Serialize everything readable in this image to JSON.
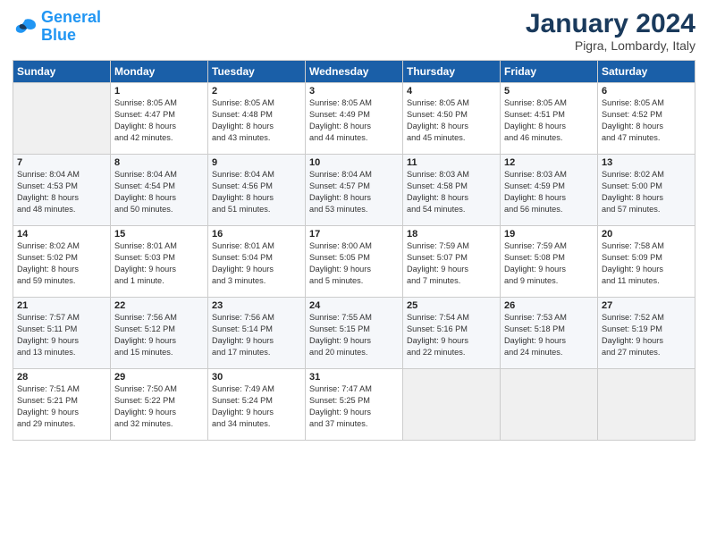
{
  "header": {
    "logo_line1": "General",
    "logo_line2": "Blue",
    "month": "January 2024",
    "location": "Pigra, Lombardy, Italy"
  },
  "weekdays": [
    "Sunday",
    "Monday",
    "Tuesday",
    "Wednesday",
    "Thursday",
    "Friday",
    "Saturday"
  ],
  "weeks": [
    [
      {
        "num": "",
        "info": ""
      },
      {
        "num": "1",
        "info": "Sunrise: 8:05 AM\nSunset: 4:47 PM\nDaylight: 8 hours\nand 42 minutes."
      },
      {
        "num": "2",
        "info": "Sunrise: 8:05 AM\nSunset: 4:48 PM\nDaylight: 8 hours\nand 43 minutes."
      },
      {
        "num": "3",
        "info": "Sunrise: 8:05 AM\nSunset: 4:49 PM\nDaylight: 8 hours\nand 44 minutes."
      },
      {
        "num": "4",
        "info": "Sunrise: 8:05 AM\nSunset: 4:50 PM\nDaylight: 8 hours\nand 45 minutes."
      },
      {
        "num": "5",
        "info": "Sunrise: 8:05 AM\nSunset: 4:51 PM\nDaylight: 8 hours\nand 46 minutes."
      },
      {
        "num": "6",
        "info": "Sunrise: 8:05 AM\nSunset: 4:52 PM\nDaylight: 8 hours\nand 47 minutes."
      }
    ],
    [
      {
        "num": "7",
        "info": "Sunrise: 8:04 AM\nSunset: 4:53 PM\nDaylight: 8 hours\nand 48 minutes."
      },
      {
        "num": "8",
        "info": "Sunrise: 8:04 AM\nSunset: 4:54 PM\nDaylight: 8 hours\nand 50 minutes."
      },
      {
        "num": "9",
        "info": "Sunrise: 8:04 AM\nSunset: 4:56 PM\nDaylight: 8 hours\nand 51 minutes."
      },
      {
        "num": "10",
        "info": "Sunrise: 8:04 AM\nSunset: 4:57 PM\nDaylight: 8 hours\nand 53 minutes."
      },
      {
        "num": "11",
        "info": "Sunrise: 8:03 AM\nSunset: 4:58 PM\nDaylight: 8 hours\nand 54 minutes."
      },
      {
        "num": "12",
        "info": "Sunrise: 8:03 AM\nSunset: 4:59 PM\nDaylight: 8 hours\nand 56 minutes."
      },
      {
        "num": "13",
        "info": "Sunrise: 8:02 AM\nSunset: 5:00 PM\nDaylight: 8 hours\nand 57 minutes."
      }
    ],
    [
      {
        "num": "14",
        "info": "Sunrise: 8:02 AM\nSunset: 5:02 PM\nDaylight: 8 hours\nand 59 minutes."
      },
      {
        "num": "15",
        "info": "Sunrise: 8:01 AM\nSunset: 5:03 PM\nDaylight: 9 hours\nand 1 minute."
      },
      {
        "num": "16",
        "info": "Sunrise: 8:01 AM\nSunset: 5:04 PM\nDaylight: 9 hours\nand 3 minutes."
      },
      {
        "num": "17",
        "info": "Sunrise: 8:00 AM\nSunset: 5:05 PM\nDaylight: 9 hours\nand 5 minutes."
      },
      {
        "num": "18",
        "info": "Sunrise: 7:59 AM\nSunset: 5:07 PM\nDaylight: 9 hours\nand 7 minutes."
      },
      {
        "num": "19",
        "info": "Sunrise: 7:59 AM\nSunset: 5:08 PM\nDaylight: 9 hours\nand 9 minutes."
      },
      {
        "num": "20",
        "info": "Sunrise: 7:58 AM\nSunset: 5:09 PM\nDaylight: 9 hours\nand 11 minutes."
      }
    ],
    [
      {
        "num": "21",
        "info": "Sunrise: 7:57 AM\nSunset: 5:11 PM\nDaylight: 9 hours\nand 13 minutes."
      },
      {
        "num": "22",
        "info": "Sunrise: 7:56 AM\nSunset: 5:12 PM\nDaylight: 9 hours\nand 15 minutes."
      },
      {
        "num": "23",
        "info": "Sunrise: 7:56 AM\nSunset: 5:14 PM\nDaylight: 9 hours\nand 17 minutes."
      },
      {
        "num": "24",
        "info": "Sunrise: 7:55 AM\nSunset: 5:15 PM\nDaylight: 9 hours\nand 20 minutes."
      },
      {
        "num": "25",
        "info": "Sunrise: 7:54 AM\nSunset: 5:16 PM\nDaylight: 9 hours\nand 22 minutes."
      },
      {
        "num": "26",
        "info": "Sunrise: 7:53 AM\nSunset: 5:18 PM\nDaylight: 9 hours\nand 24 minutes."
      },
      {
        "num": "27",
        "info": "Sunrise: 7:52 AM\nSunset: 5:19 PM\nDaylight: 9 hours\nand 27 minutes."
      }
    ],
    [
      {
        "num": "28",
        "info": "Sunrise: 7:51 AM\nSunset: 5:21 PM\nDaylight: 9 hours\nand 29 minutes."
      },
      {
        "num": "29",
        "info": "Sunrise: 7:50 AM\nSunset: 5:22 PM\nDaylight: 9 hours\nand 32 minutes."
      },
      {
        "num": "30",
        "info": "Sunrise: 7:49 AM\nSunset: 5:24 PM\nDaylight: 9 hours\nand 34 minutes."
      },
      {
        "num": "31",
        "info": "Sunrise: 7:47 AM\nSunset: 5:25 PM\nDaylight: 9 hours\nand 37 minutes."
      },
      {
        "num": "",
        "info": ""
      },
      {
        "num": "",
        "info": ""
      },
      {
        "num": "",
        "info": ""
      }
    ]
  ]
}
